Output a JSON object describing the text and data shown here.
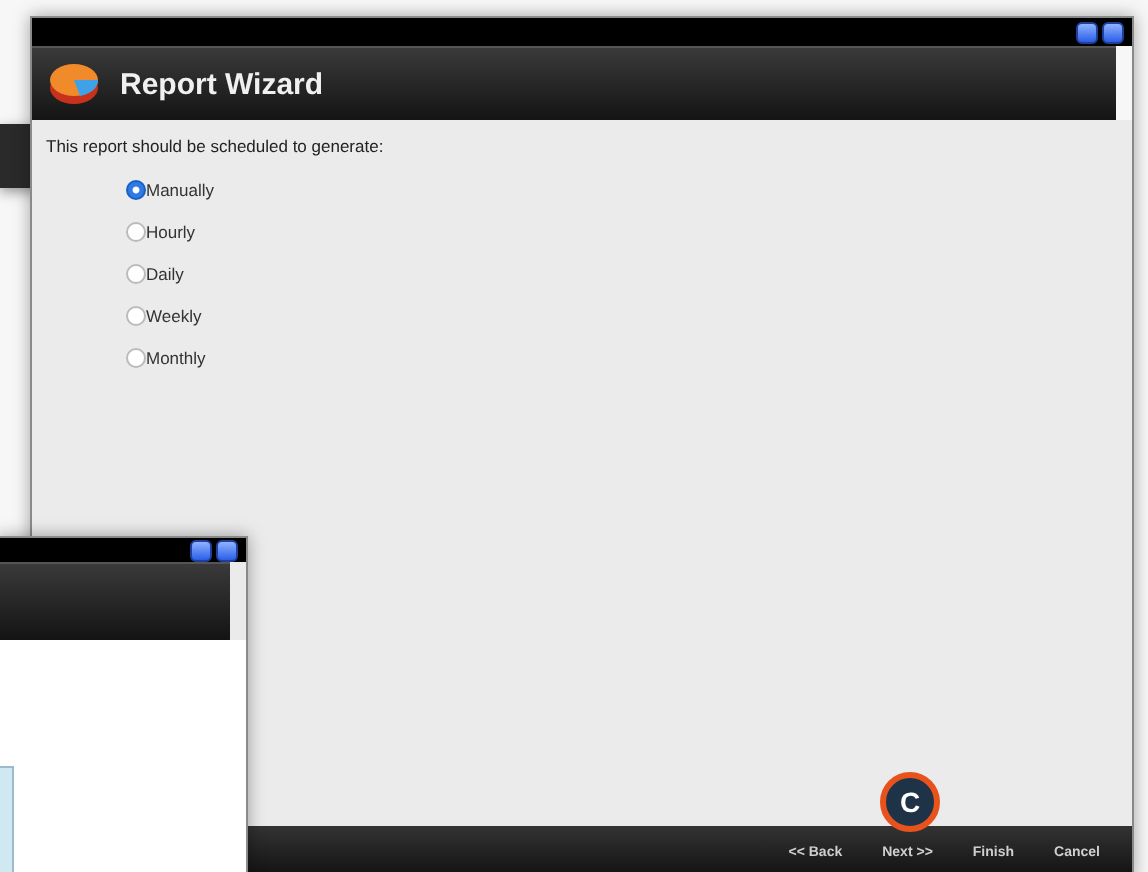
{
  "wizard": {
    "title": "Report Wizard",
    "prompt": "This report should be scheduled to generate:",
    "options": [
      {
        "label": "Manually",
        "selected": true
      },
      {
        "label": "Hourly",
        "selected": false
      },
      {
        "label": "Daily",
        "selected": false
      },
      {
        "label": "Weekly",
        "selected": false
      },
      {
        "label": "Monthly",
        "selected": false
      }
    ],
    "buttons": [
      "<< Back",
      "Next >>",
      "Finish",
      "Cancel"
    ]
  },
  "callout": {
    "label": "C"
  }
}
